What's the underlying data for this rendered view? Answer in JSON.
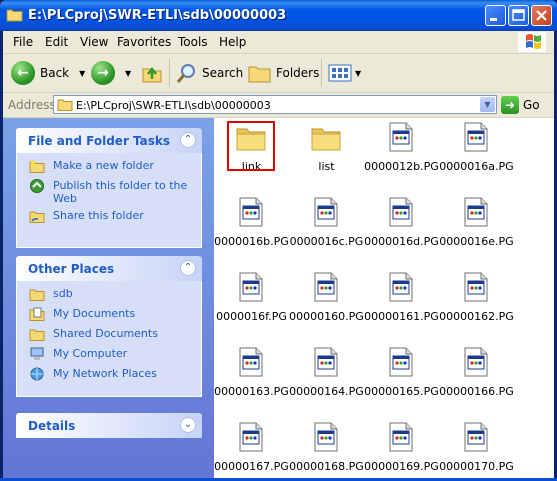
{
  "window": {
    "title": "E:\\PLCproj\\SWR-ETLI\\sdb\\00000003"
  },
  "menu": [
    "File",
    "Edit",
    "View",
    "Favorites",
    "Tools",
    "Help"
  ],
  "toolbar": {
    "back": "Back",
    "search": "Search",
    "folders": "Folders"
  },
  "address": {
    "label": "Address",
    "value": "E:\\PLCproj\\SWR-ETLI\\sdb\\00000003",
    "go": "Go"
  },
  "tasks": {
    "file_folder": {
      "title": "File and Folder Tasks",
      "items": [
        "Make a new folder",
        "Publish this folder to the Web",
        "Share this folder"
      ]
    },
    "other_places": {
      "title": "Other Places",
      "items": [
        "sdb",
        "My Documents",
        "Shared Documents",
        "My Computer",
        "My Network Places"
      ]
    },
    "details": {
      "title": "Details"
    }
  },
  "files": [
    {
      "name": "link",
      "type": "folder"
    },
    {
      "name": "list",
      "type": "folder"
    },
    {
      "name": "0000012b.PG",
      "type": "pg"
    },
    {
      "name": "0000016a.PG",
      "type": "pg"
    },
    {
      "name": "0000016b.PG",
      "type": "pg"
    },
    {
      "name": "0000016c.PG",
      "type": "pg"
    },
    {
      "name": "0000016d.PG",
      "type": "pg"
    },
    {
      "name": "0000016e.PG",
      "type": "pg"
    },
    {
      "name": "0000016f.PG",
      "type": "pg"
    },
    {
      "name": "00000160.PG",
      "type": "pg"
    },
    {
      "name": "00000161.PG",
      "type": "pg"
    },
    {
      "name": "00000162.PG",
      "type": "pg"
    },
    {
      "name": "00000163.PG",
      "type": "pg"
    },
    {
      "name": "00000164.PG",
      "type": "pg"
    },
    {
      "name": "00000165.PG",
      "type": "pg"
    },
    {
      "name": "00000166.PG",
      "type": "pg"
    },
    {
      "name": "00000167.PG",
      "type": "pg"
    },
    {
      "name": "00000168.PG",
      "type": "pg"
    },
    {
      "name": "00000169.PG",
      "type": "pg"
    },
    {
      "name": "00000170.PG",
      "type": "pg"
    }
  ],
  "colors": {
    "selection_outline": "#e00000",
    "link": "#215dc6"
  }
}
